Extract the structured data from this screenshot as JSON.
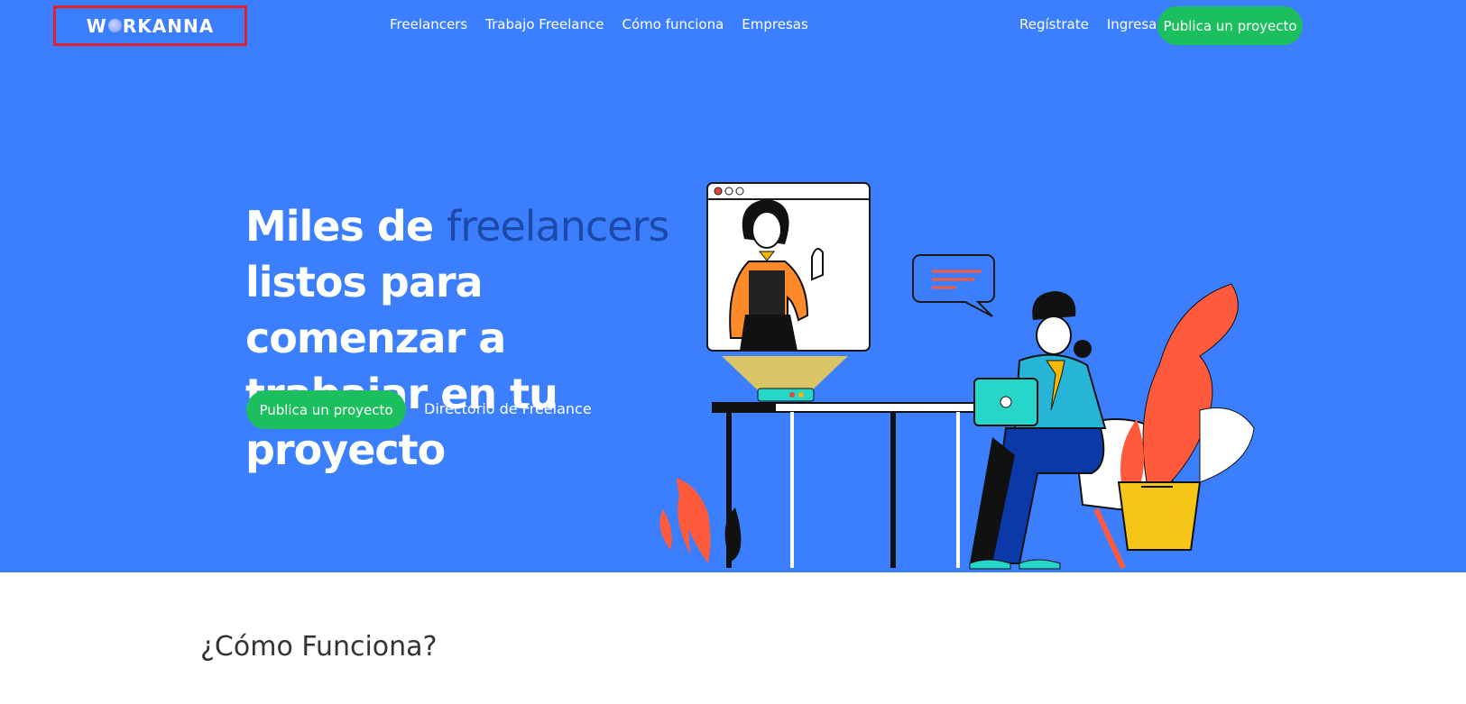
{
  "brand": {
    "logo_prefix": "W",
    "logo_suffix": "RKANNA"
  },
  "nav": {
    "items": [
      {
        "label": "Freelancers"
      },
      {
        "label": "Trabajo Freelance"
      },
      {
        "label": "Cómo funciona"
      },
      {
        "label": "Empresas"
      }
    ]
  },
  "auth": {
    "register": "Regístrate",
    "login": "Ingresa",
    "cta": "Publica un proyecto"
  },
  "hero": {
    "line1_prefix": "Miles de ",
    "line1_highlight": "freelancers",
    "line2": "listos para comenzar a",
    "line3": "trabajar en tu proyecto",
    "cta": "Publica un proyecto",
    "directory_link": "Directorio de Freelance"
  },
  "section": {
    "title": "¿Cómo Funciona?"
  },
  "colors": {
    "hero_bg": "#3b7fff",
    "accent_green": "#1cbf5e",
    "highlight_blue": "#1d4aa8",
    "logo_frame": "#e0202a"
  }
}
